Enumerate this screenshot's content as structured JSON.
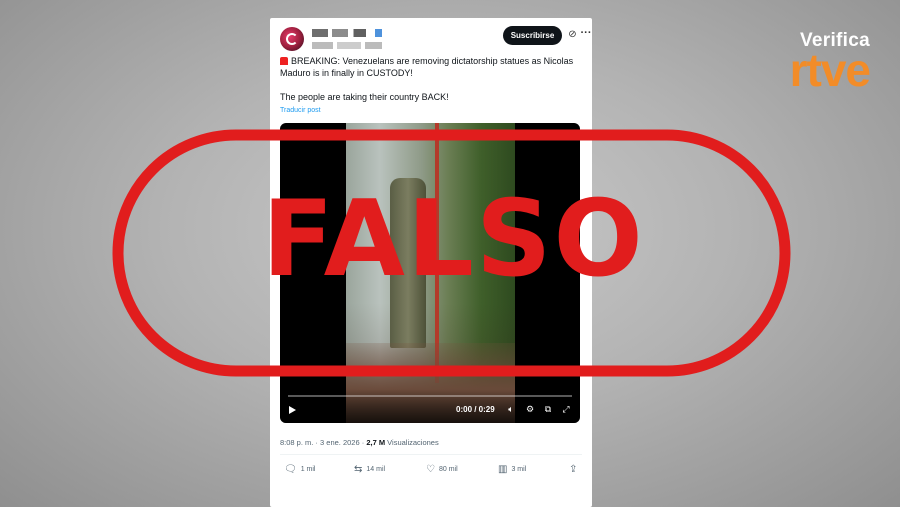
{
  "brand": {
    "verifica": "Verifica",
    "rtve": "rtve"
  },
  "tweet": {
    "subscribe_label": "Suscribirse",
    "text_line1": "BREAKING: Venezuelans are removing dictatorship statues as Nicolas Maduro is in finally in CUSTODY!",
    "text_line2": "The people are taking their country BACK!",
    "translate_label": "Traducir post",
    "video": {
      "time": "0:00 / 0:29"
    },
    "meta": {
      "time_date": "8:08 p. m. · 3 ene. 2026 · ",
      "views_count": "2,7 M",
      "views_label": " Visualizaciones"
    },
    "actions": {
      "replies": "1 mil",
      "reposts": "14 mil",
      "likes": "80 mil",
      "bookmarks": "3 mil"
    }
  },
  "stamp": {
    "label": "FALSO"
  },
  "colors": {
    "stamp_red": "#e11d1d",
    "brand_orange": "#f28c28",
    "link_blue": "#1d9bf0"
  }
}
